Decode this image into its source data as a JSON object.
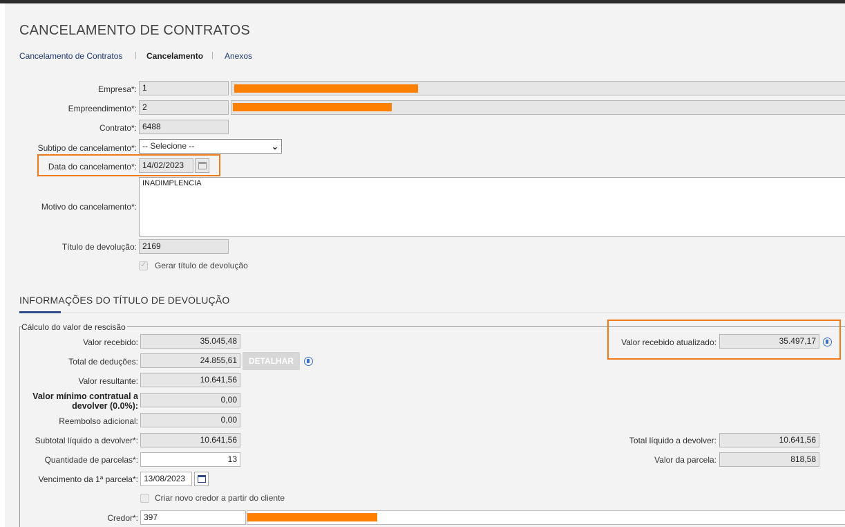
{
  "page": {
    "title": "CANCELAMENTO DE CONTRATOS"
  },
  "breadcrumb": [
    "Cancelamento de Contratos",
    "Cancelamento",
    "Anexos"
  ],
  "form": {
    "empresa": {
      "label": "Empresa*:",
      "value": "1"
    },
    "empreendimento": {
      "label": "Empreendimento*:",
      "value": "2"
    },
    "contrato": {
      "label": "Contrato*:",
      "value": "6488"
    },
    "subtipo": {
      "label": "Subtipo de cancelamento*:",
      "value": "-- Selecione --"
    },
    "data_cancelamento": {
      "label": "Data do cancelamento*:",
      "value": "14/02/2023"
    },
    "motivo": {
      "label": "Motivo do cancelamento*:",
      "value": "INADIMPLENCIA"
    },
    "titulo_devolucao": {
      "label": "Título de devolução:",
      "value": "2169"
    },
    "gerar_titulo": {
      "label": "Gerar título de devolução",
      "checked": true
    }
  },
  "section": {
    "title": "INFORMAÇÕES DO TÍTULO DE DEVOLUÇÃO",
    "legend": "Cálculo do valor de rescisão",
    "valor_recebido": {
      "label": "Valor recebido:",
      "value": "35.045,48"
    },
    "total_deducoes": {
      "label": "Total de deduções:",
      "value": "24.855,61"
    },
    "detalhar_label": "DETALHAR",
    "valor_resultante": {
      "label": "Valor resultante:",
      "value": "10.641,56"
    },
    "valor_minimo": {
      "label_line1": "Valor mínimo contratual a",
      "label_line2": "devolver (0.0%):",
      "value": "0,00"
    },
    "reembolso": {
      "label": "Reembolso adicional:",
      "value": "0,00"
    },
    "subtotal": {
      "label": "Subtotal líquido a devolver*:",
      "value": "10.641,56"
    },
    "qtd_parcelas": {
      "label": "Quantidade de parcelas*:",
      "value": "13"
    },
    "vencimento": {
      "label": "Vencimento da 1ª parcela*:",
      "value": "13/08/2023"
    },
    "criar_credor": {
      "label": "Criar novo credor a partir do cliente",
      "checked": false
    },
    "credor": {
      "label": "Credor*:",
      "value": "397"
    },
    "valor_recebido_atualizado": {
      "label": "Valor recebido atualizado:",
      "value": "35.497,17"
    },
    "total_liquido": {
      "label": "Total líquido a devolver:",
      "value": "10.641,56"
    },
    "valor_parcela": {
      "label": "Valor da parcela:",
      "value": "818,58"
    }
  },
  "colors": {
    "highlight": "#f07a1a",
    "redaction": "#ff7f00",
    "accent": "#2f4a8a"
  },
  "icons": [
    "calendar-icon",
    "info-icon",
    "chevron-down-icon",
    "checkbox"
  ]
}
